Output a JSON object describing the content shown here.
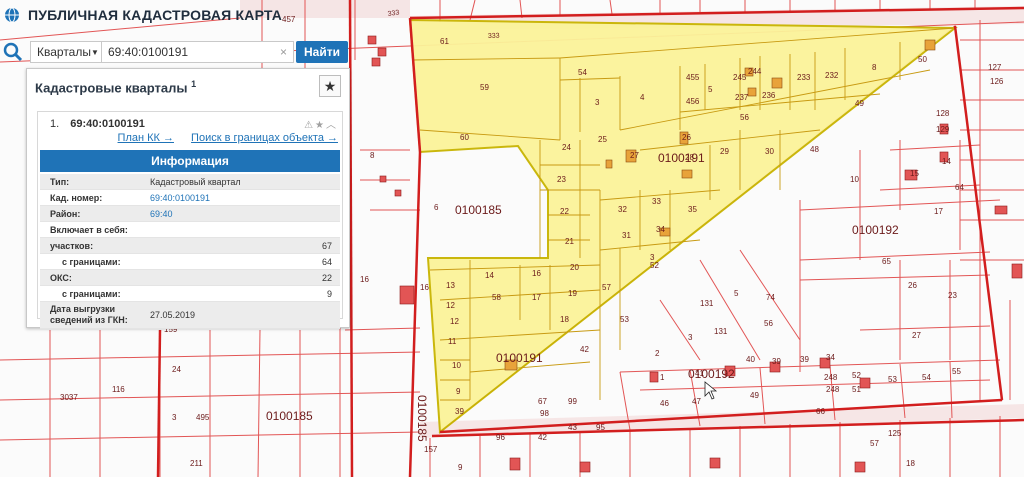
{
  "app": {
    "title": "ПУБЛИЧНАЯ КАДАСТРОВАЯ КАРТА"
  },
  "search": {
    "type_label": "Кварталы",
    "query": "69:40:0100191",
    "clear": "×",
    "go": "Найти"
  },
  "panel": {
    "title": "Кадастровые кварталы",
    "count": "1",
    "result": {
      "index": "1.",
      "number": "69:40:0100191",
      "link_plan": "План КК →",
      "link_search": "Поиск в границах объекта →",
      "info_header": "Информация",
      "rows": {
        "type_k": "Тип:",
        "type_v": "Кадастровый квартал",
        "cad_k": "Кад. номер:",
        "cad_v": "69:40:0100191",
        "region_k": "Район:",
        "region_v": "69:40",
        "incl_k": "Включает в себя:",
        "parcels_k": "участков:",
        "parcels_v": "67",
        "parcels_b_k": "с границами:",
        "parcels_b_v": "64",
        "oks_k": "ОКС:",
        "oks_v": "22",
        "oks_b_k": "с границами:",
        "oks_b_v": "9",
        "date_k1": "Дата выгрузки",
        "date_k2": "сведений из ГКН:",
        "date_v": "27.05.2019"
      }
    }
  },
  "map": {
    "quarters": [
      "0100185",
      "0100191",
      "0100192",
      "0100185",
      "0100191",
      "0100192",
      "0100191",
      "0100185"
    ],
    "roads": [
      "333",
      "333"
    ],
    "parcels": [
      "61",
      "59",
      "54",
      "3",
      "4",
      "455",
      "456",
      "245",
      "244",
      "237",
      "236",
      "233",
      "232",
      "8",
      "50",
      "49",
      "60",
      "5",
      "56",
      "24",
      "25",
      "26",
      "27",
      "28",
      "29",
      "30",
      "48",
      "23",
      "22",
      "21",
      "20",
      "32",
      "33",
      "34",
      "35",
      "31",
      "52",
      "14",
      "16",
      "13",
      "58",
      "17",
      "19",
      "12",
      "18",
      "57",
      "53",
      "11",
      "10",
      "9",
      "39",
      "42",
      "6",
      "8",
      "16",
      "16",
      "457",
      "159",
      "495",
      "116",
      "211",
      "3",
      "24",
      "3037",
      "3",
      "12",
      "40",
      "34",
      "39",
      "41",
      "47",
      "46",
      "49",
      "1",
      "2",
      "3",
      "131",
      "131",
      "5",
      "74",
      "56",
      "23",
      "26",
      "27",
      "17",
      "15",
      "10",
      "14",
      "129",
      "128",
      "127",
      "126",
      "65",
      "64",
      "66",
      "96",
      "42",
      "43",
      "95",
      "99",
      "67",
      "98",
      "125",
      "57",
      "55",
      "54",
      "53",
      "52",
      "248",
      "248",
      "51",
      "39",
      "9",
      "157",
      "18"
    ]
  },
  "colors": {
    "selected_fill": "#fbf39a",
    "selected_stroke": "#c8b400",
    "line": "#e04646",
    "accent": "#1f73b7"
  }
}
